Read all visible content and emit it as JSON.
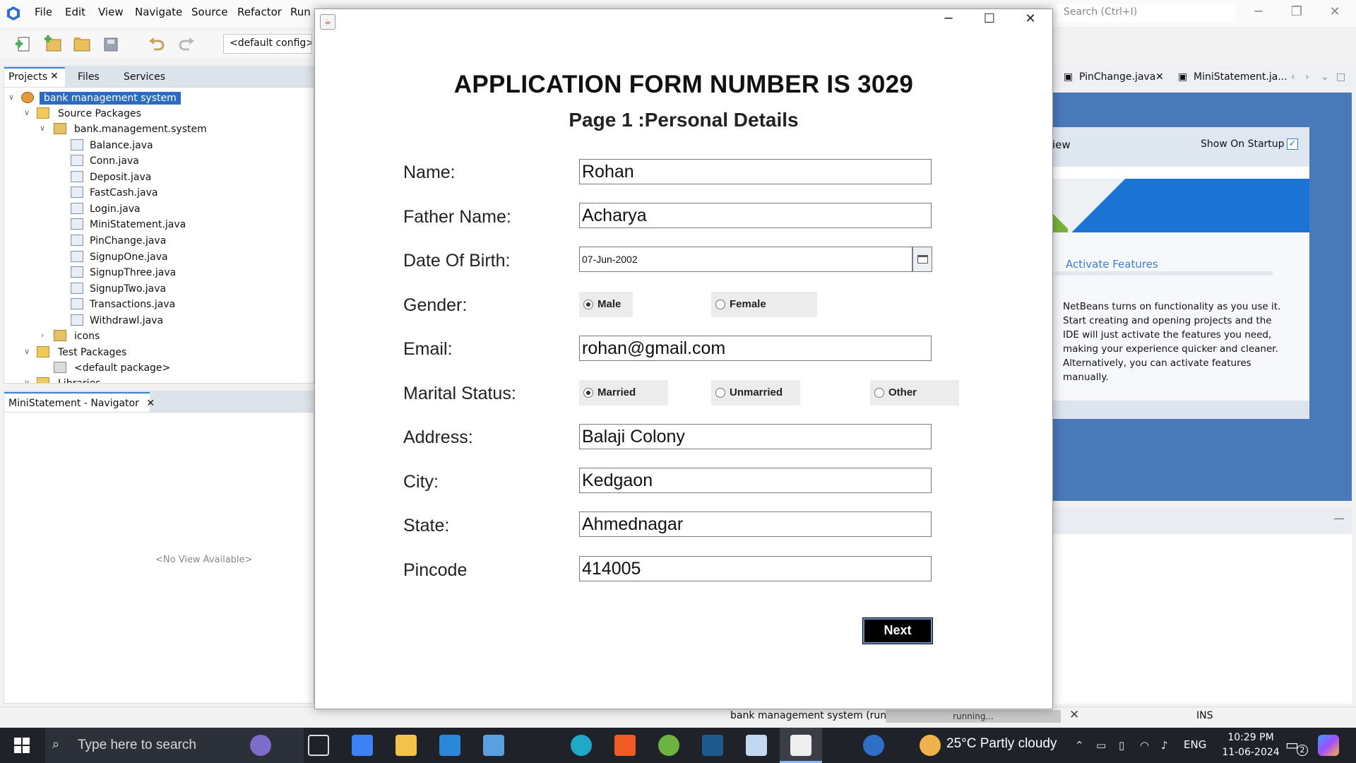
{
  "ide": {
    "menu": [
      "File",
      "Edit",
      "View",
      "Navigate",
      "Source",
      "Refactor",
      "Run"
    ],
    "search_placeholder": "Search (Ctrl+I)",
    "config": "<default config>",
    "panel_tabs": [
      "Projects",
      "Files",
      "Services"
    ],
    "tree": {
      "project": "bank management  system",
      "source_packages": "Source Packages",
      "package": "bank.management.system",
      "files": [
        "Balance.java",
        "Conn.java",
        "Deposit.java",
        "FastCash.java",
        "Login.java",
        "MiniStatement.java",
        "PinChange.java",
        "SignupOne.java",
        "SignupThree.java",
        "SignupTwo.java",
        "Transactions.java",
        "Withdrawl.java"
      ],
      "icons": "icons",
      "test_packages": "Test Packages",
      "default_package": "<default package>",
      "libraries": "Libraries"
    },
    "navigator_title": "MiniStatement - Navigator",
    "no_view": "<No View Available>",
    "editor_tabs": [
      "PinChange.java",
      "MiniStatement.ja..."
    ],
    "start_page": {
      "partial_tab": "iew",
      "show_on_startup": "Show On Startup",
      "activate_link": "Activate Features",
      "text": "NetBeans turns on functionality as you use it. Start creating and opening projects and the IDE will just activate the features you need, making your experience quicker and cleaner. Alternatively, you can activate features manually."
    },
    "status": {
      "run_label": "bank management  system (run)",
      "progress": "running...",
      "mode": "INS"
    }
  },
  "form": {
    "title": "APPLICATION FORM NUMBER IS 3029",
    "subtitle": "Page 1 :Personal Details",
    "labels": {
      "name": "Name:",
      "father": "Father Name:",
      "dob": "Date Of Birth:",
      "gender": "Gender:",
      "email": "Email:",
      "marital": "Marital Status:",
      "address": "Address:",
      "city": "City:",
      "state": "State:",
      "pincode": "Pincode"
    },
    "values": {
      "name": "Rohan",
      "father": "Acharya",
      "dob": "07-Jun-2002",
      "email": "rohan@gmail.com",
      "address": "Balaji Colony",
      "city": "Kedgaon",
      "state": "Ahmednagar",
      "pincode": "414005"
    },
    "gender_options": [
      "Male",
      "Female"
    ],
    "gender_selected": "Male",
    "marital_options": [
      "Married",
      "Unmarried",
      "Other"
    ],
    "marital_selected": "Married",
    "next_label": "Next"
  },
  "taskbar": {
    "search_placeholder": "Type here to search",
    "weather": "25°C  Partly cloudy",
    "language": "ENG",
    "time": "10:29 PM",
    "date": "11-06-2024",
    "notifications": "2"
  },
  "colors": {
    "accent": "#3b7ed8",
    "selection": "#2c6bc2",
    "taskbar": "#1f2329",
    "next_button": "#000000"
  }
}
